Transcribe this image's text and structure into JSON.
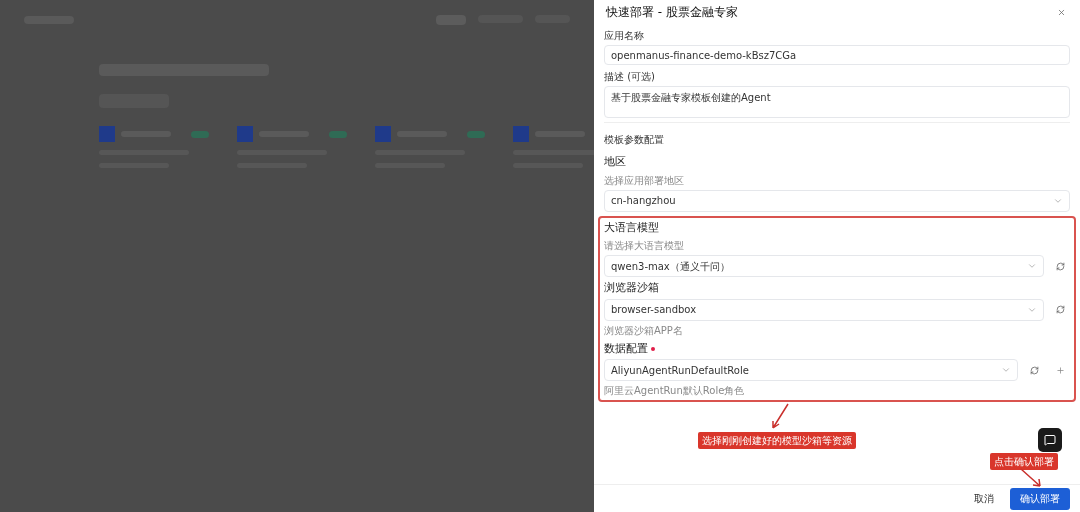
{
  "drawer": {
    "title": "快速部署 - 股票金融专家",
    "fields": [
      {
        "kind": "input",
        "label": "应用名称",
        "value": "openmanus-finance-demo-kBsz7CGa"
      },
      {
        "kind": "textarea",
        "label": "描述 (可选)",
        "value": "基于股票金融专家模板创建的Agent"
      }
    ],
    "section_title": "模板参数配置",
    "params": [
      {
        "label": "地区",
        "required": false,
        "hint": "选择应用部署地区",
        "value": "cn-hangzhou",
        "refresh": false,
        "add": false
      },
      {
        "label": "大语言模型",
        "required": false,
        "hint": "请选择大语言模型",
        "value": "qwen3-max（通义千问）",
        "refresh": true,
        "add": false
      },
      {
        "label": "浏览器沙箱",
        "required": false,
        "value": "browser-sandbox",
        "refresh": true,
        "add": false,
        "help": "浏览器沙箱APP名"
      },
      {
        "label": "数据配置",
        "required": true,
        "value": "AliyunAgentRunDefaultRole",
        "refresh": true,
        "add": true,
        "help": "阿里云AgentRun默认Role角色"
      }
    ],
    "buttons": [
      {
        "label": "取消",
        "kind": "secondary"
      },
      {
        "label": "确认部署",
        "kind": "primary"
      }
    ]
  },
  "annotations": [
    {
      "text": "选择刚刚创建好的模型沙箱等资源"
    },
    {
      "text": "点击确认部署"
    }
  ]
}
